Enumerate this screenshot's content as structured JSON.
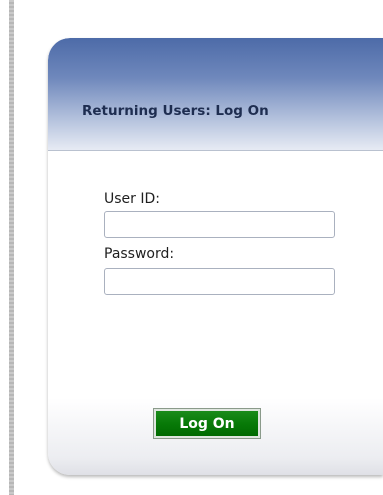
{
  "login_card": {
    "title": "Returning Users: Log On",
    "user_id_label": "User ID:",
    "user_id_value": "",
    "password_label": "Password:",
    "password_value": "",
    "submit_label": "Log On"
  },
  "colors": {
    "header_gradient_top": "#4d6ba8",
    "title_text": "#1e2d50",
    "button_bg": "#087a08",
    "button_text": "#ffffff"
  }
}
